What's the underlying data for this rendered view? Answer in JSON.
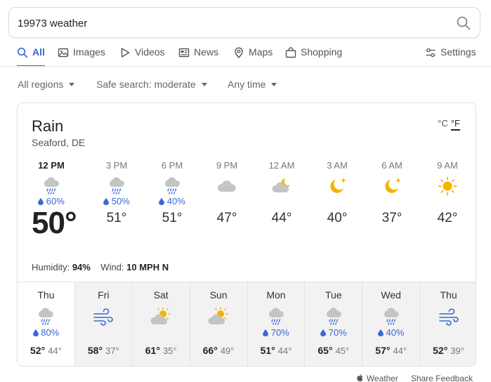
{
  "search": {
    "query": "19973 weather"
  },
  "tabs": [
    {
      "label": "All",
      "icon": "search-icon"
    },
    {
      "label": "Images",
      "icon": "image-icon"
    },
    {
      "label": "Videos",
      "icon": "play-icon"
    },
    {
      "label": "News",
      "icon": "newspaper-icon"
    },
    {
      "label": "Maps",
      "icon": "map-pin-icon"
    },
    {
      "label": "Shopping",
      "icon": "shopping-bag-icon"
    }
  ],
  "settings_label": "Settings",
  "filters": {
    "region": "All regions",
    "safe": "Safe search: moderate",
    "time": "Any time"
  },
  "weather": {
    "condition": "Rain",
    "location": "Seaford, DE",
    "unit_c": "°C",
    "unit_f": "°F",
    "now": {
      "time": "12 PM",
      "precip": "60%",
      "temp": "50°",
      "icon": "rain-cloud-icon"
    },
    "hourly": [
      {
        "time": "3 PM",
        "precip": "50%",
        "temp": "51°",
        "icon": "rain-cloud-icon"
      },
      {
        "time": "6 PM",
        "precip": "40%",
        "temp": "51°",
        "icon": "rain-cloud-icon"
      },
      {
        "time": "9 PM",
        "precip": "",
        "temp": "47°",
        "icon": "cloud-icon"
      },
      {
        "time": "12 AM",
        "precip": "",
        "temp": "44°",
        "icon": "cloud-moon-icon"
      },
      {
        "time": "3 AM",
        "precip": "",
        "temp": "40°",
        "icon": "moon-star-icon"
      },
      {
        "time": "6 AM",
        "precip": "",
        "temp": "37°",
        "icon": "moon-star-icon"
      },
      {
        "time": "9 AM",
        "precip": "",
        "temp": "42°",
        "icon": "sun-icon"
      }
    ],
    "humidity_label": "Humidity:",
    "humidity": "94%",
    "wind_label": "Wind:",
    "wind": "10 MPH N",
    "daily": [
      {
        "day": "Thu",
        "precip": "80%",
        "hi": "52°",
        "lo": "44°",
        "icon": "rain-cloud-icon"
      },
      {
        "day": "Fri",
        "precip": "",
        "hi": "58°",
        "lo": "37°",
        "icon": "wind-icon"
      },
      {
        "day": "Sat",
        "precip": "",
        "hi": "61°",
        "lo": "35°",
        "icon": "partly-cloudy-icon"
      },
      {
        "day": "Sun",
        "precip": "",
        "hi": "66°",
        "lo": "49°",
        "icon": "partly-cloudy-icon"
      },
      {
        "day": "Mon",
        "precip": "70%",
        "hi": "51°",
        "lo": "44°",
        "icon": "rain-cloud-icon"
      },
      {
        "day": "Tue",
        "precip": "70%",
        "hi": "65°",
        "lo": "45°",
        "icon": "rain-cloud-icon"
      },
      {
        "day": "Wed",
        "precip": "40%",
        "hi": "57°",
        "lo": "44°",
        "icon": "rain-cloud-icon"
      },
      {
        "day": "Thu",
        "precip": "",
        "hi": "52°",
        "lo": "39°",
        "icon": "wind-icon"
      }
    ]
  },
  "footer": {
    "weather_brand": "Weather",
    "feedback": "Share Feedback"
  },
  "colors": {
    "accent": "#3a66d8",
    "sun": "#f5b400",
    "cloud": "#c4c4c4",
    "drop": "#3a66d8",
    "wind": "#3a66d8"
  }
}
